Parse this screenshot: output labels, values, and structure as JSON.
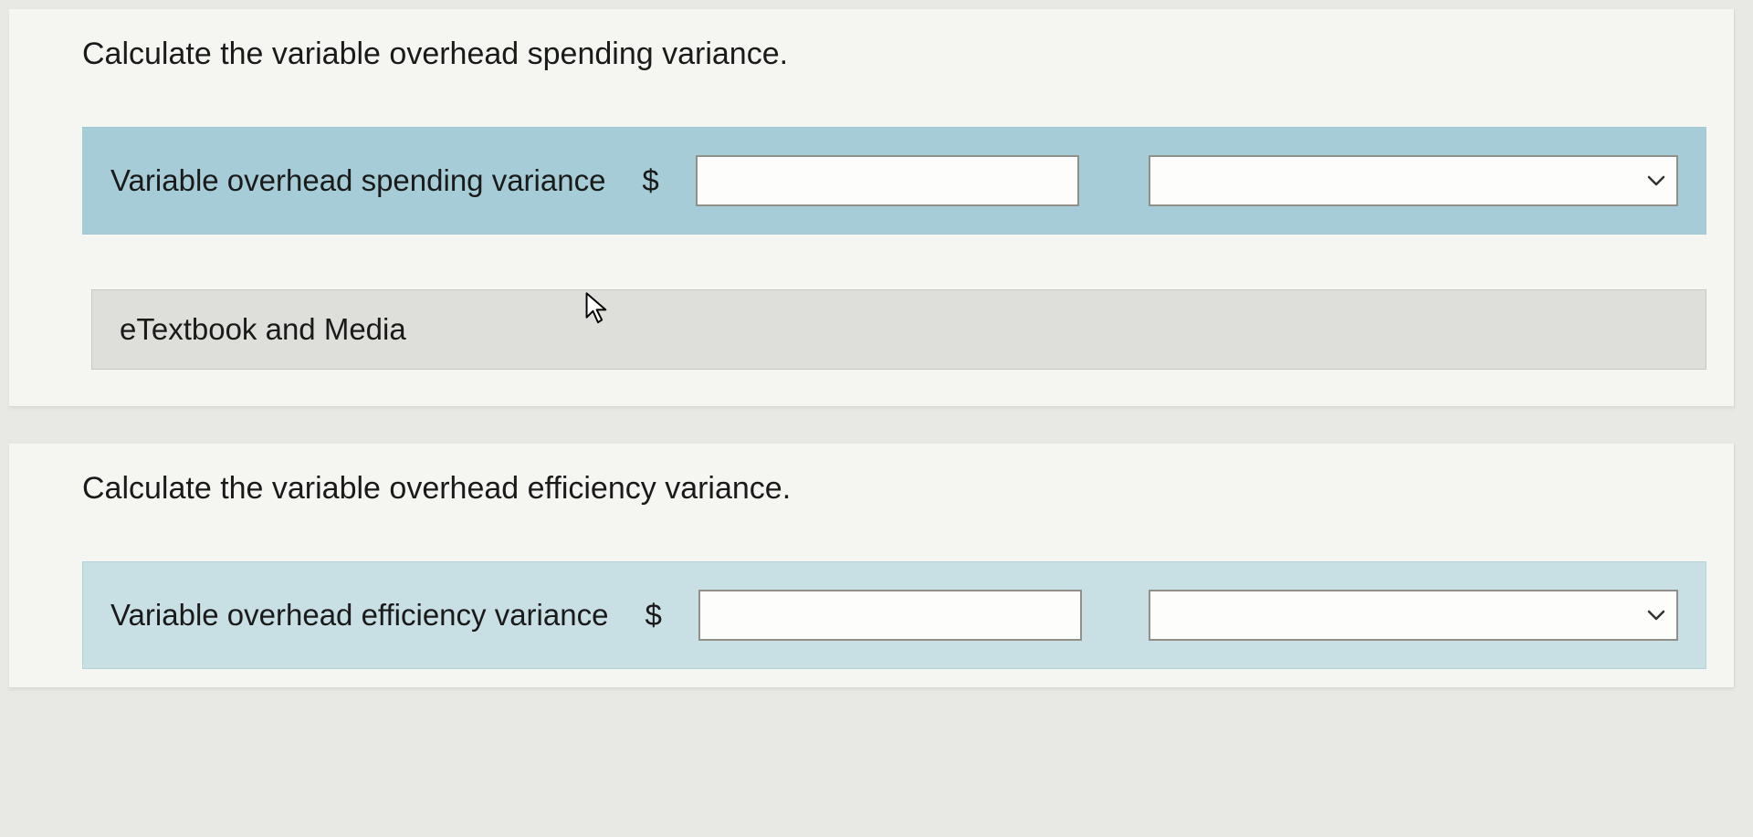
{
  "question1": {
    "prompt": "Calculate the variable overhead spending variance.",
    "row_label": "Variable overhead spending variance",
    "currency": "$",
    "value": "",
    "select_value": ""
  },
  "media_bar": {
    "label": "eTextbook and Media"
  },
  "question2": {
    "prompt": "Calculate the variable overhead efficiency variance.",
    "row_label": "Variable overhead efficiency variance",
    "currency": "$",
    "value": "",
    "select_value": ""
  }
}
